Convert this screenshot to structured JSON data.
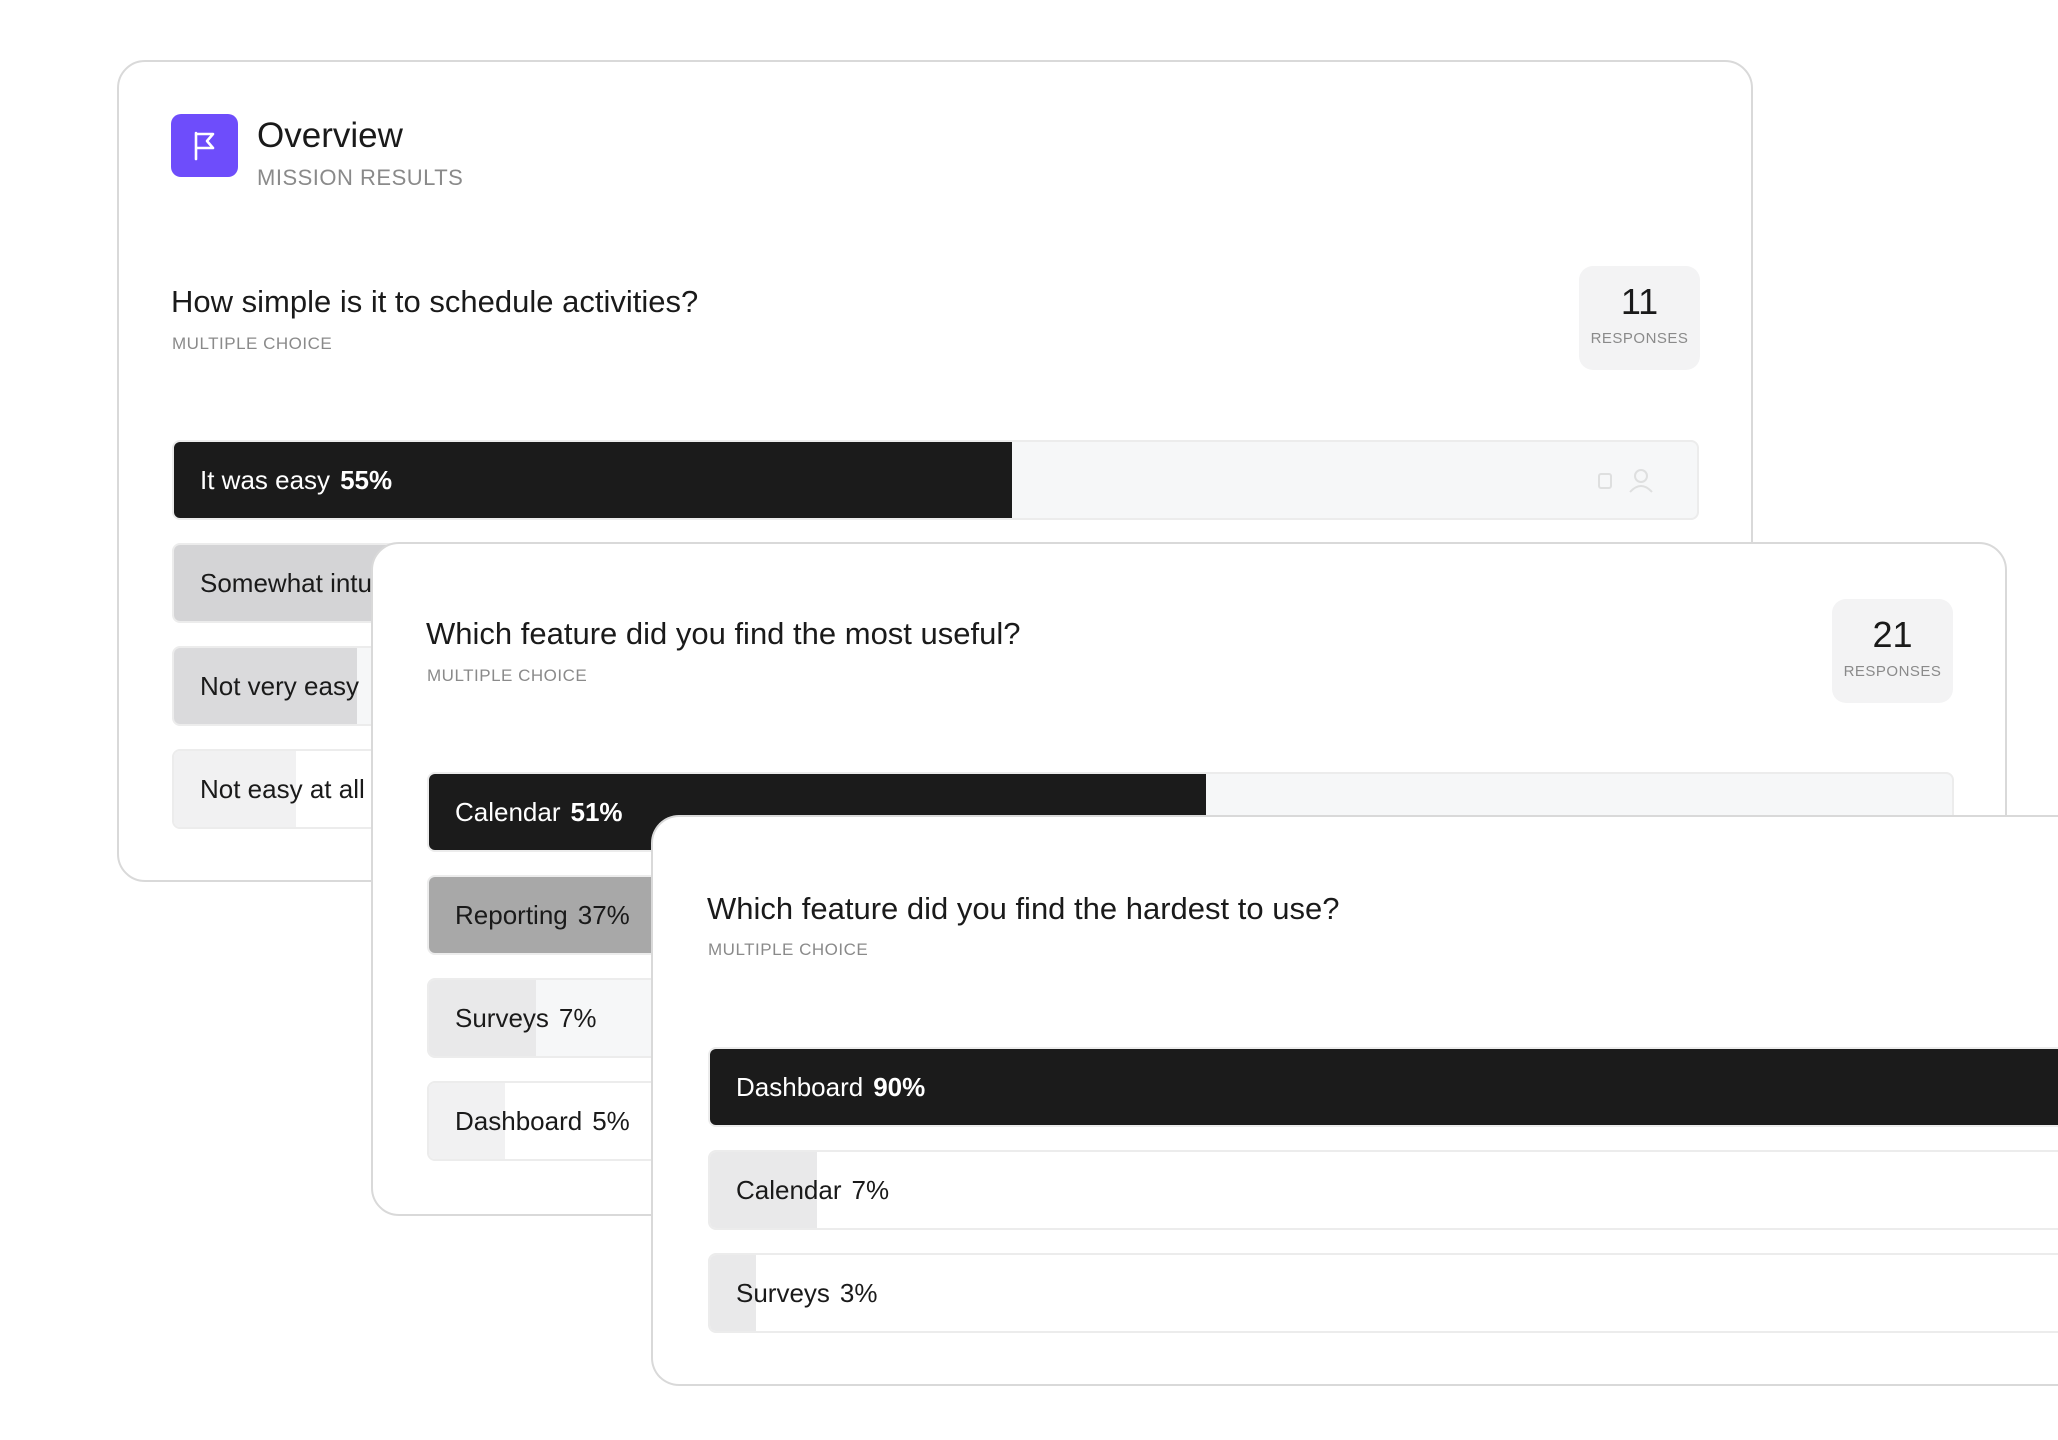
{
  "overview": {
    "title": "Overview",
    "subtitle": "MISSION RESULTS",
    "icon": "flag-icon",
    "accent": "#6e4dfb"
  },
  "questions": [
    {
      "title": "How simple is it to schedule activities?",
      "type": "MULTIPLE CHOICE",
      "responses": "11",
      "responses_label": "RESPONSES",
      "options": [
        {
          "label": "It was easy",
          "pct": "55%",
          "value": 55
        },
        {
          "label": "Somewhat intu",
          "pct": "",
          "value": 25
        },
        {
          "label": "Not very easy",
          "pct": "",
          "value": 12
        },
        {
          "label": "Not easy at all",
          "pct": "",
          "value": 8
        }
      ]
    },
    {
      "title": "Which feature did you find the most useful?",
      "type": "MULTIPLE CHOICE",
      "responses": "21",
      "responses_label": "RESPONSES",
      "options": [
        {
          "label": "Calendar",
          "pct": "51%",
          "value": 51
        },
        {
          "label": "Reporting",
          "pct": "37%",
          "value": 37
        },
        {
          "label": "Surveys",
          "pct": "7%",
          "value": 7
        },
        {
          "label": "Dashboard",
          "pct": "5%",
          "value": 5
        }
      ]
    },
    {
      "title": "Which feature did you find the hardest to use?",
      "type": "MULTIPLE CHOICE",
      "options": [
        {
          "label": "Dashboard",
          "pct": "90%",
          "value": 90
        },
        {
          "label": "Calendar",
          "pct": "7%",
          "value": 7
        },
        {
          "label": "Surveys",
          "pct": "3%",
          "value": 3
        }
      ]
    }
  ],
  "colors": {
    "top_fill": "#1b1b1b",
    "second_fill": "#a8a8a8",
    "light_fill": "#e9e9ea",
    "lighter_fill": "#f1f1f2"
  }
}
